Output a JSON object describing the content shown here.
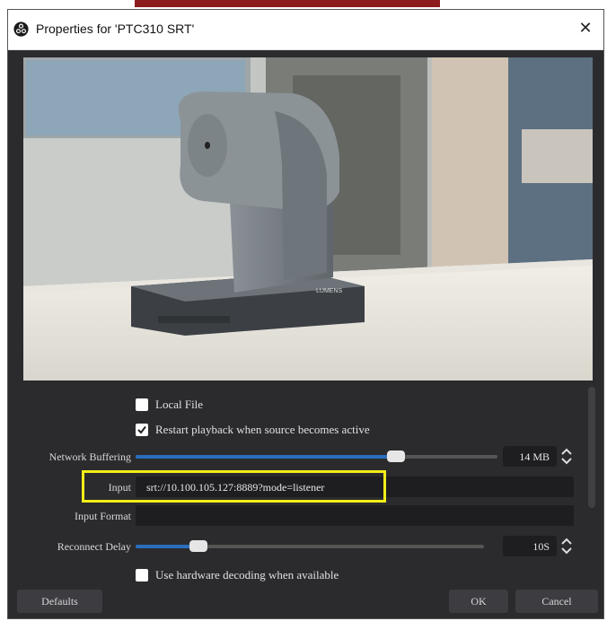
{
  "window": {
    "title": "Properties for 'PTC310 SRT'"
  },
  "preview": {
    "camera_label": "LUMENS"
  },
  "local_file": {
    "label": "Local File",
    "checked": false
  },
  "restart_playback": {
    "label": "Restart playback when source becomes active",
    "checked": true
  },
  "network_buffering": {
    "label": "Network Buffering",
    "value": "14 MB",
    "level": 0.72
  },
  "input": {
    "label": "Input",
    "value": "srt://10.100.105.127:8889?mode=listener"
  },
  "input_format": {
    "label": "Input Format",
    "value": ""
  },
  "reconnect_delay": {
    "label": "Reconnect Delay",
    "value": "10S",
    "level": 0.18
  },
  "hw_decoding": {
    "label": "Use hardware decoding when available",
    "checked": false
  },
  "buttons": {
    "defaults": "Defaults",
    "ok": "OK",
    "cancel": "Cancel"
  },
  "colors": {
    "highlight": "#f2ee18",
    "accent": "#2a6ebd",
    "window_bg": "#2b2b2e"
  }
}
